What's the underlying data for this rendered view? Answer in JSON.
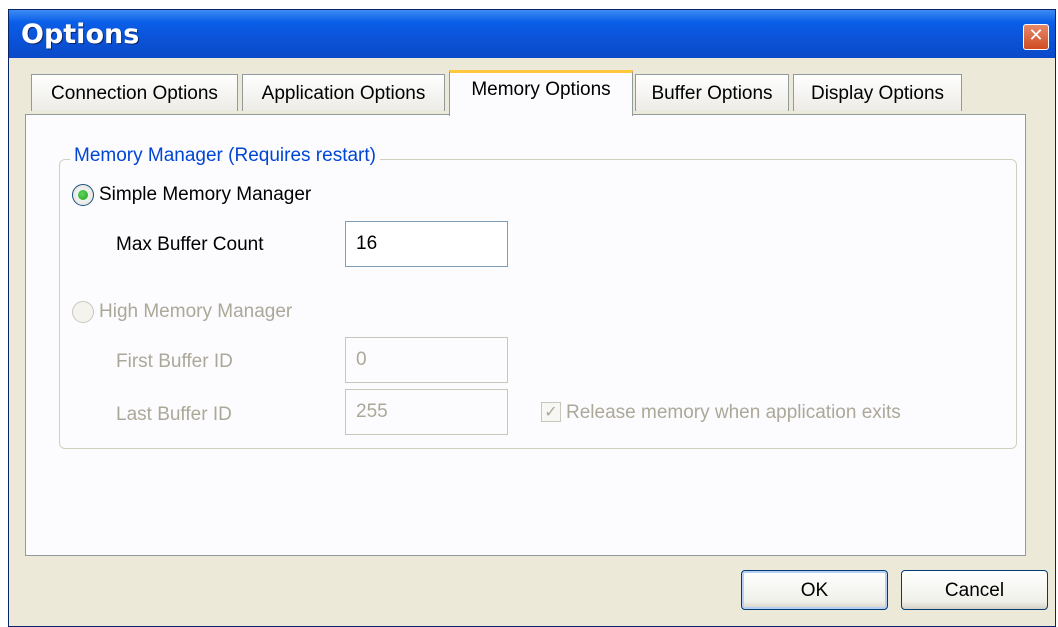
{
  "window": {
    "title": "Options",
    "close_glyph": "✕"
  },
  "tabs": [
    {
      "label": "Connection Options",
      "active": false
    },
    {
      "label": "Application Options",
      "active": false
    },
    {
      "label": "Memory Options",
      "active": true
    },
    {
      "label": "Buffer Options",
      "active": false
    },
    {
      "label": "Display Options",
      "active": false
    }
  ],
  "memory_manager": {
    "group_label": "Memory Manager (Requires restart)",
    "simple": {
      "label": "Simple Memory Manager",
      "selected": true,
      "max_buffer_count_label": "Max Buffer Count",
      "max_buffer_count_value": "16"
    },
    "high": {
      "label": "High Memory Manager",
      "selected": false,
      "enabled": false,
      "first_buffer_id_label": "First Buffer ID",
      "first_buffer_id_value": "0",
      "last_buffer_id_label": "Last Buffer ID",
      "last_buffer_id_value": "255",
      "release_memory_label": "Release memory when application exits",
      "release_memory_checked": true,
      "check_glyph": "✓"
    }
  },
  "buttons": {
    "ok_label": "OK",
    "cancel_label": "Cancel"
  },
  "colors": {
    "title_bar": "#0a5ee8",
    "group_label": "#0046d5",
    "disabled_text": "#aca899",
    "active_tab_highlight": "#ffc83c"
  }
}
